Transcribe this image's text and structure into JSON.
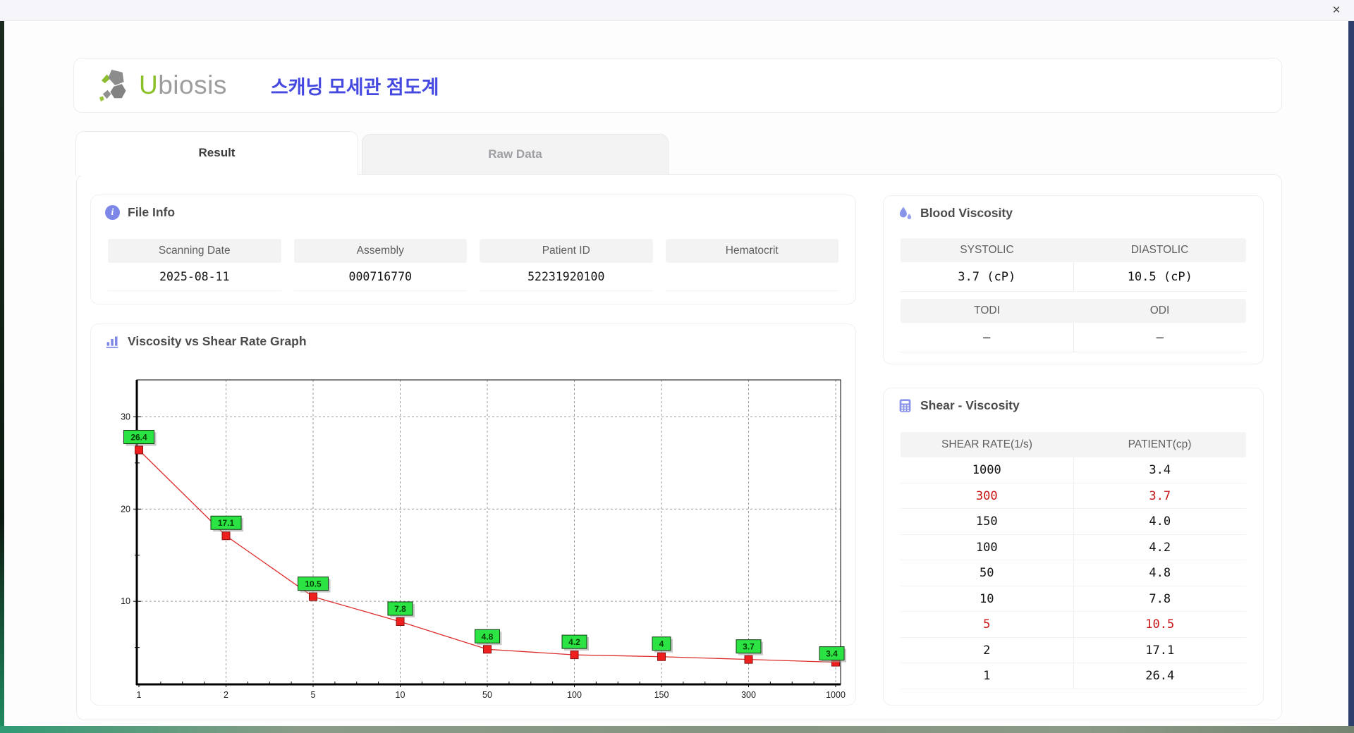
{
  "window": {
    "close_label": "×"
  },
  "header": {
    "brand": "Ubiosis",
    "brand_u": "U",
    "brand_rest": "biosis",
    "app_title_korean": "스캐닝 모세관 점도계"
  },
  "tabs": [
    {
      "label": "Result",
      "active": true
    },
    {
      "label": "Raw Data",
      "active": false
    }
  ],
  "file_info": {
    "title": "File Info",
    "fields": [
      {
        "label": "Scanning Date",
        "value": "2025-08-11"
      },
      {
        "label": "Assembly",
        "value": "000716770"
      },
      {
        "label": "Patient ID",
        "value": "52231920100"
      },
      {
        "label": "Hematocrit",
        "value": ""
      }
    ]
  },
  "graph": {
    "title": "Viscosity vs Shear Rate Graph"
  },
  "blood_viscosity": {
    "title": "Blood Viscosity",
    "items": [
      {
        "label": "SYSTOLIC",
        "value": "3.7 (cP)"
      },
      {
        "label": "DIASTOLIC",
        "value": "10.5 (cP)"
      },
      {
        "label": "TODI",
        "value": "–"
      },
      {
        "label": "ODI",
        "value": "–"
      }
    ]
  },
  "shear_table": {
    "title": "Shear - Viscosity",
    "columns": [
      "SHEAR RATE(1/s)",
      "PATIENT(cp)"
    ],
    "highlight_color": "#c81414",
    "rows": [
      {
        "shear_rate": "1000",
        "patient": "3.4",
        "highlight": false
      },
      {
        "shear_rate": "300",
        "patient": "3.7",
        "highlight": true
      },
      {
        "shear_rate": "150",
        "patient": "4.0",
        "highlight": false
      },
      {
        "shear_rate": "100",
        "patient": "4.2",
        "highlight": false
      },
      {
        "shear_rate": "50",
        "patient": "4.8",
        "highlight": false
      },
      {
        "shear_rate": "10",
        "patient": "7.8",
        "highlight": false
      },
      {
        "shear_rate": "5",
        "patient": "10.5",
        "highlight": true
      },
      {
        "shear_rate": "2",
        "patient": "17.1",
        "highlight": false
      },
      {
        "shear_rate": "1",
        "patient": "26.4",
        "highlight": false
      }
    ]
  },
  "chart_data": {
    "type": "line",
    "title": "Viscosity vs Shear Rate Graph",
    "xlabel": "",
    "ylabel": "",
    "x_categories": [
      "1",
      "2",
      "5",
      "10",
      "50",
      "100",
      "150",
      "300",
      "1000"
    ],
    "series": [
      {
        "name": "Patient",
        "values": [
          26.4,
          17.1,
          10.5,
          7.8,
          4.8,
          4.2,
          4,
          3.7,
          3.4
        ]
      }
    ],
    "point_labels": [
      "26.4",
      "17.1",
      "10.5",
      "7.8",
      "4.8",
      "4.2",
      "4",
      "3.7",
      "3.4"
    ],
    "ylim": [
      1,
      34
    ],
    "y_ticks": [
      10,
      20,
      30
    ],
    "y_minor_ticks": [
      5,
      15,
      25
    ],
    "grid": "dashed",
    "legend": "none",
    "grid_color": "#9b9b9b",
    "line_color": "#dd2c2c",
    "marker_fill": "#ef1f1f",
    "marker_border": "#8b1111",
    "label_bg": "#2be343",
    "label_border": "#123b12",
    "label_text": "#064006"
  }
}
